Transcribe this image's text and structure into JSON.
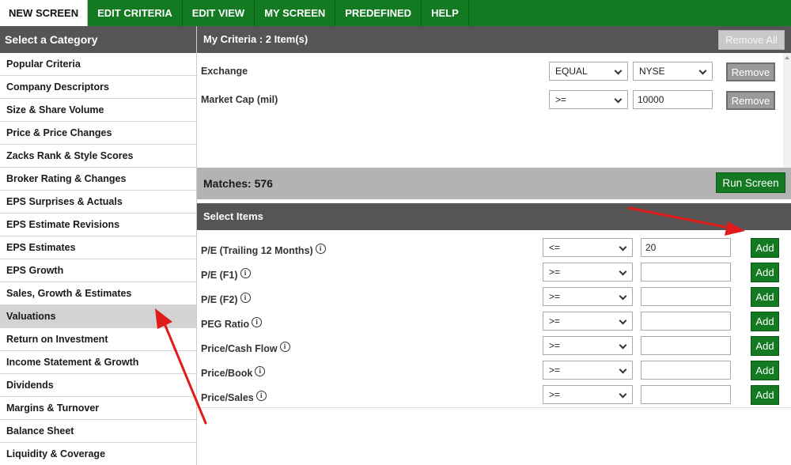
{
  "tabs": [
    {
      "label": "NEW SCREEN",
      "active": true
    },
    {
      "label": "EDIT CRITERIA",
      "active": false
    },
    {
      "label": "EDIT VIEW",
      "active": false
    },
    {
      "label": "MY SCREEN",
      "active": false
    },
    {
      "label": "PREDEFINED",
      "active": false
    },
    {
      "label": "HELP",
      "active": false
    }
  ],
  "sidebar": {
    "title": "Select a Category",
    "items": [
      "Popular Criteria",
      "Company Descriptors",
      "Size & Share Volume",
      "Price & Price Changes",
      "Zacks Rank & Style Scores",
      "Broker Rating & Changes",
      "EPS Surprises & Actuals",
      "EPS Estimate Revisions",
      "EPS Estimates",
      "EPS Growth",
      "Sales, Growth & Estimates",
      "Valuations",
      "Return on Investment",
      "Income Statement & Growth",
      "Dividends",
      "Margins & Turnover",
      "Balance Sheet",
      "Liquidity & Coverage"
    ],
    "selected": "Valuations"
  },
  "criteria": {
    "title": "My Criteria : 2 Item(s)",
    "remove_all_label": "Remove All",
    "rows": [
      {
        "label": "Exchange",
        "operator": "EQUAL",
        "value": "NYSE",
        "value_is_select": true,
        "remove_label": "Remove"
      },
      {
        "label": "Market Cap (mil)",
        "operator": ">=",
        "value": "10000",
        "value_is_select": false,
        "remove_label": "Remove"
      }
    ]
  },
  "matches": {
    "text": "Matches: 576",
    "run_label": "Run Screen"
  },
  "select_items": {
    "title": "Select Items",
    "info_glyph": "i",
    "rows": [
      {
        "label": "P/E (Trailing 12 Months)",
        "operator": "<=",
        "value": "20",
        "add_label": "Add"
      },
      {
        "label": "P/E (F1)",
        "operator": ">=",
        "value": "",
        "add_label": "Add"
      },
      {
        "label": "P/E (F2)",
        "operator": ">=",
        "value": "",
        "add_label": "Add"
      },
      {
        "label": "PEG Ratio",
        "operator": ">=",
        "value": "",
        "add_label": "Add"
      },
      {
        "label": "Price/Cash Flow",
        "operator": ">=",
        "value": "",
        "add_label": "Add"
      },
      {
        "label": "Price/Book",
        "operator": ">=",
        "value": "",
        "add_label": "Add"
      },
      {
        "label": "Price/Sales",
        "operator": ">=",
        "value": "",
        "add_label": "Add"
      }
    ]
  },
  "colors": {
    "brand_green": "#137a22",
    "header_gray": "#555555",
    "annotation_red": "#e01b1b"
  }
}
